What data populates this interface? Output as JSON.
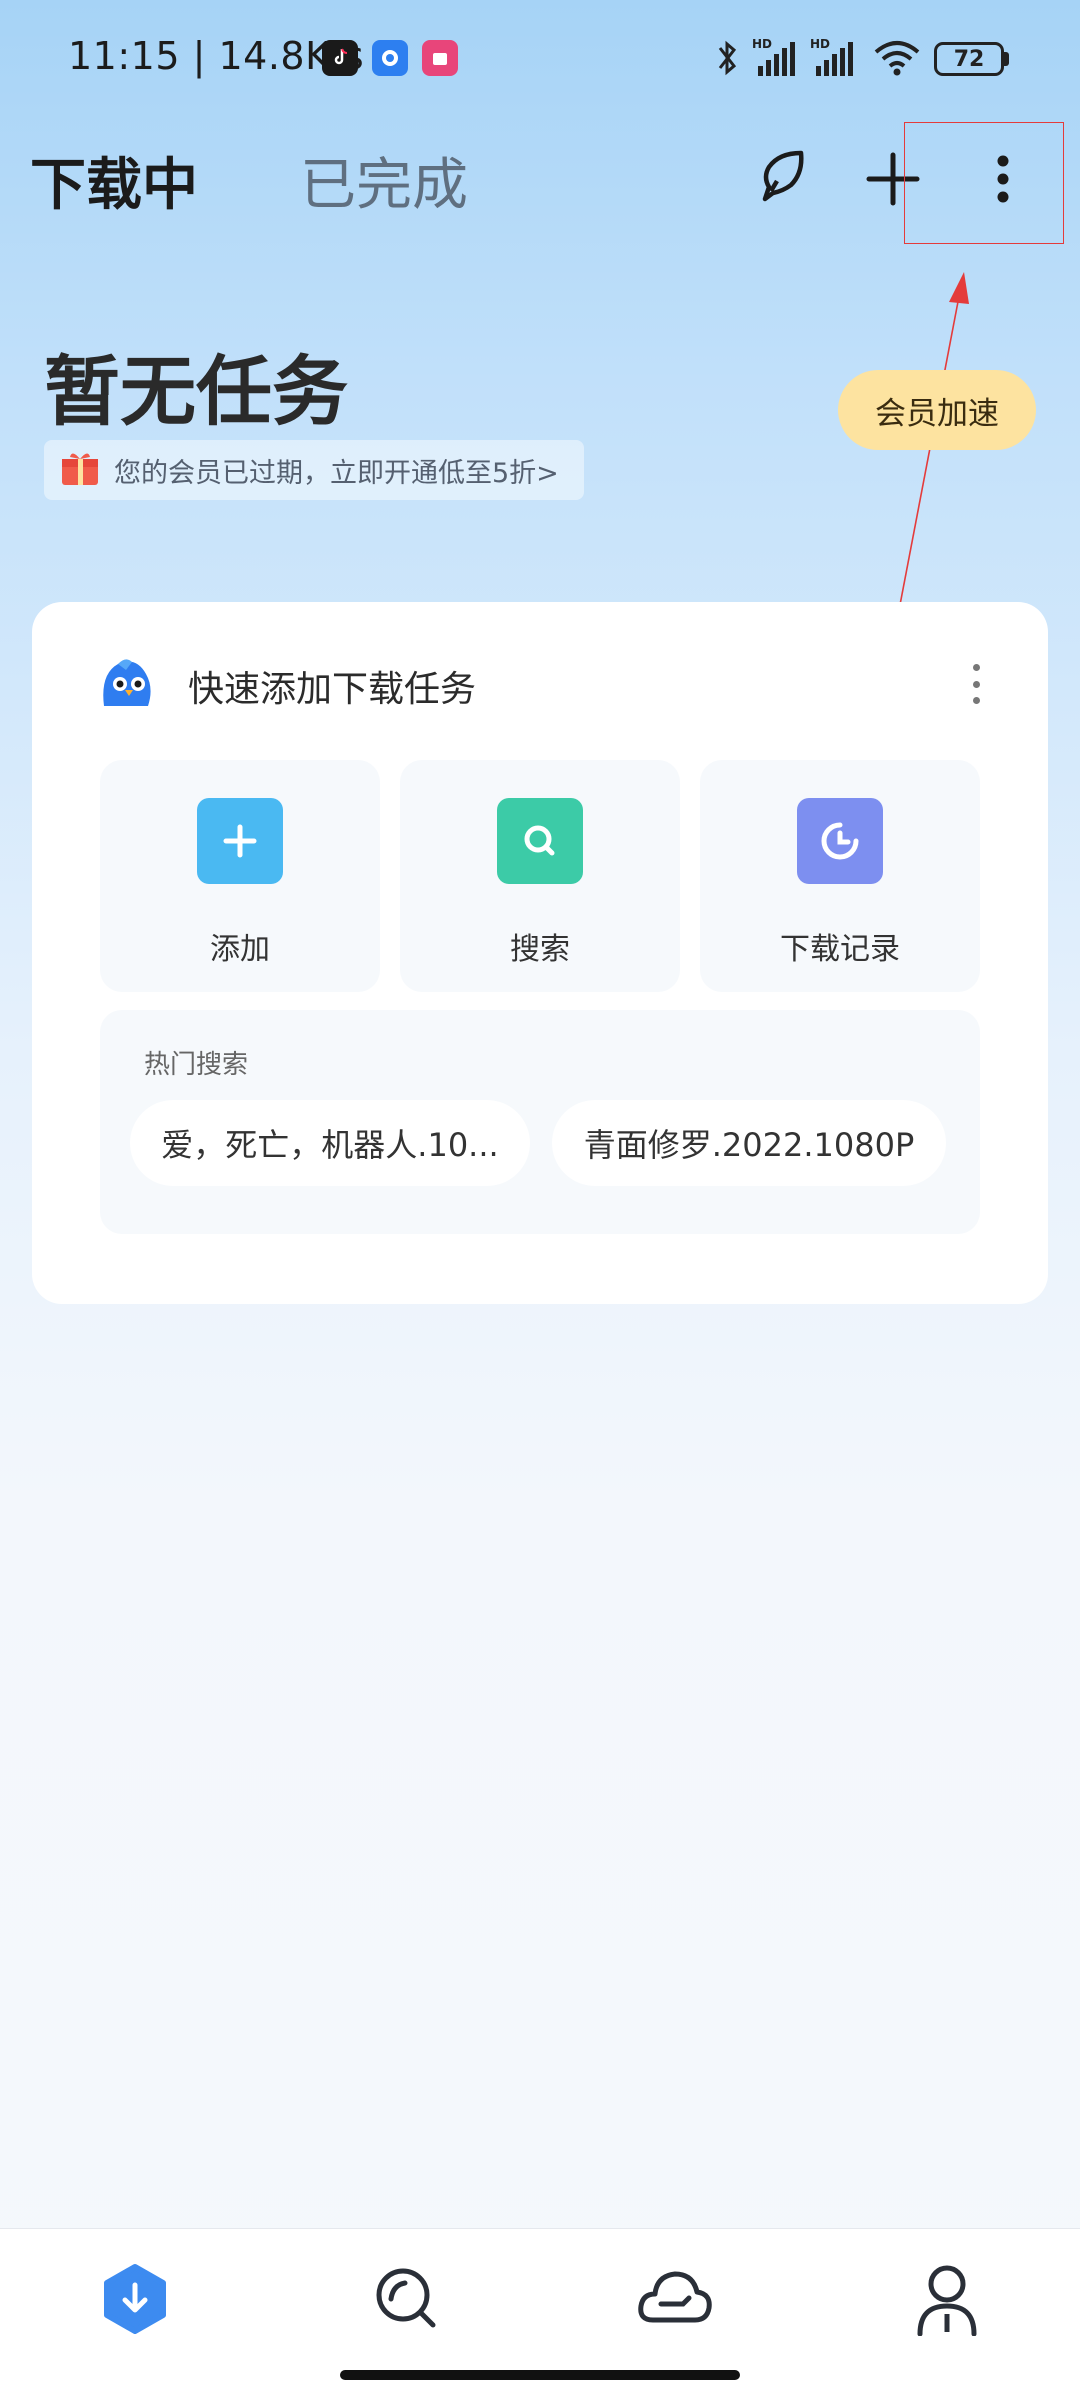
{
  "status_bar": {
    "time": "11:15",
    "network_speed": "14.8K/s",
    "battery": "72",
    "signal_label_1": "HD",
    "signal_label_2": "HD"
  },
  "header": {
    "tab_active": "下载中",
    "tab_inactive": "已完成"
  },
  "empty_state": {
    "title": "暂无任务",
    "promo_text": "您的会员已过期，立即开通低至5折>",
    "vip_button": "会员加速"
  },
  "quick_add": {
    "title": "快速添加下载任务",
    "actions": [
      {
        "label": "添加",
        "icon": "plus-icon",
        "color": "#4ab9f2"
      },
      {
        "label": "搜索",
        "icon": "search-icon",
        "color": "#3ccba7"
      },
      {
        "label": "下载记录",
        "icon": "clock-icon",
        "color": "#7d8ff0"
      }
    ],
    "hot_search_title": "热门搜索",
    "hot_searches": [
      "爱，死亡，机器人.10...",
      "青面修罗.2022.1080P"
    ]
  },
  "bottom_nav": [
    {
      "name": "download-tab",
      "icon": "download-icon",
      "active": true
    },
    {
      "name": "discover-tab",
      "icon": "magnifier-icon",
      "active": false
    },
    {
      "name": "cloud-tab",
      "icon": "cloud-icon",
      "active": false
    },
    {
      "name": "profile-tab",
      "icon": "person-icon",
      "active": false
    }
  ],
  "colors": {
    "accent": "#3d8bf0",
    "vip": "#fde3a0",
    "annotation": "#e43b3b"
  }
}
